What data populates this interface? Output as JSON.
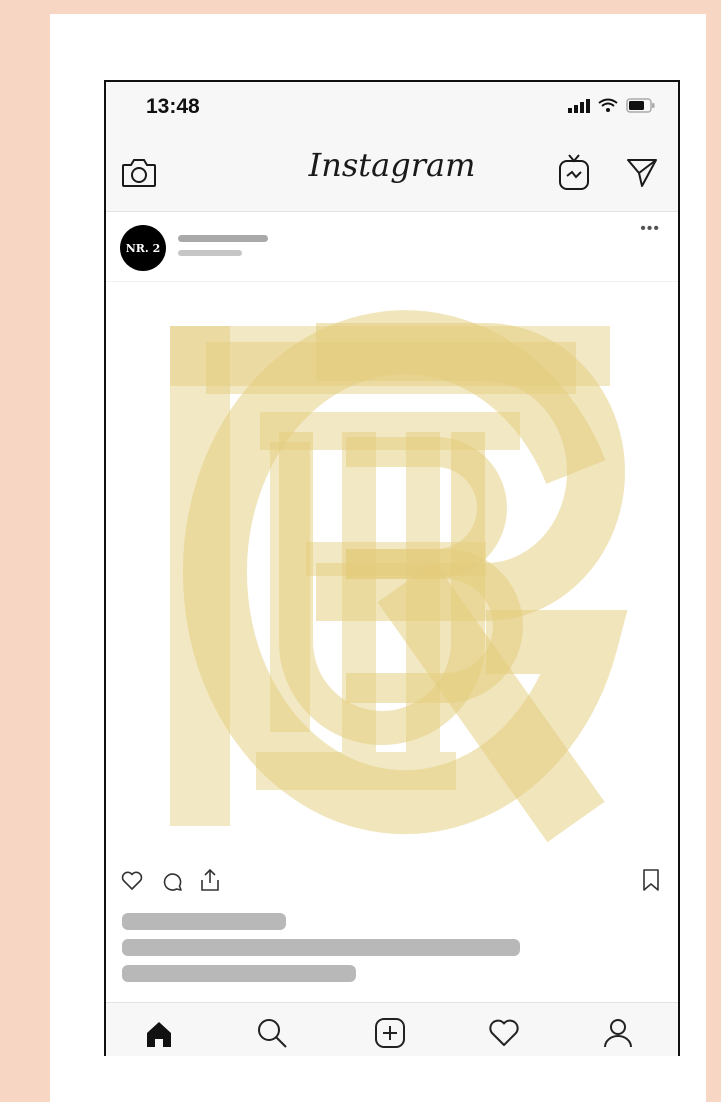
{
  "status_bar": {
    "time": "13:48",
    "icons": [
      "signal-icon",
      "wifi-icon",
      "battery-icon"
    ]
  },
  "nav": {
    "title": "Instagram",
    "left_icon": "camera-icon",
    "right_icons": [
      "igtv-icon",
      "send-icon"
    ]
  },
  "post": {
    "avatar_text": "NR. 2",
    "more_icon": "more-icon",
    "image_icon": "monogram-logo",
    "logo_color": "#e3cc7a",
    "action_icons": [
      "heart-icon",
      "comment-icon",
      "share-icon"
    ],
    "bookmark_icon": "bookmark-icon"
  },
  "tab_bar": {
    "items": [
      "home-icon",
      "search-icon",
      "add-post-icon",
      "activity-heart-icon",
      "profile-icon"
    ]
  },
  "colors": {
    "background": "#f7d7c4",
    "placeholder_bar": "#b8b8b8",
    "ui_bars": "#f7f7f7"
  }
}
